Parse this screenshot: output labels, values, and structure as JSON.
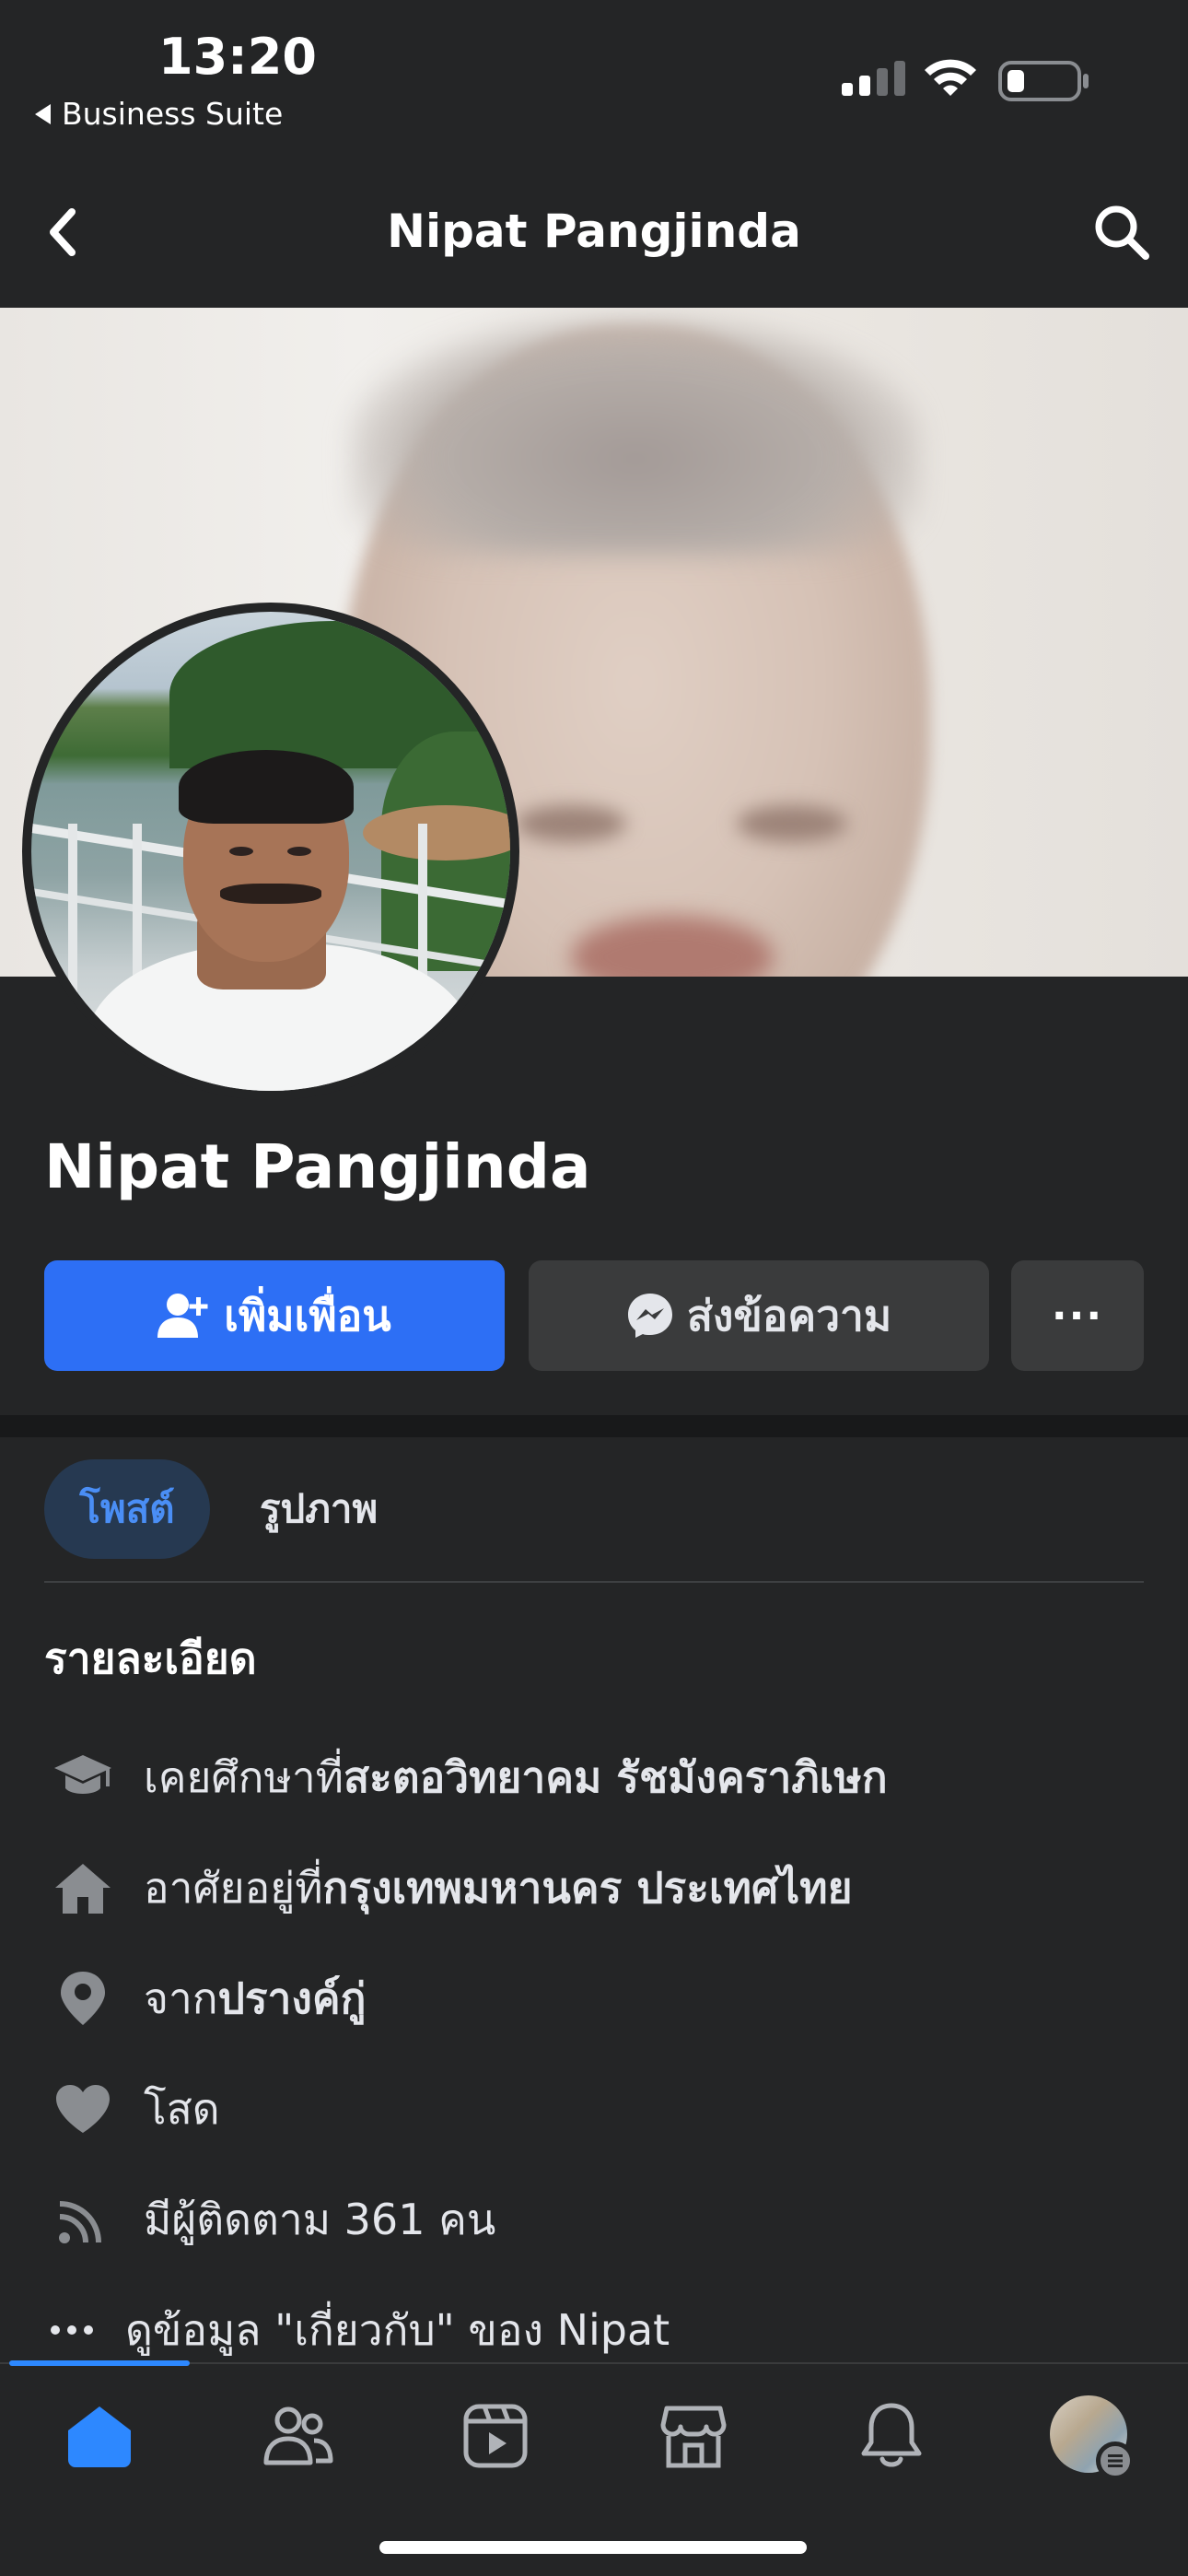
{
  "status_bar": {
    "time": "13:20",
    "back_app": "Business Suite"
  },
  "header": {
    "title": "Nipat Pangjinda"
  },
  "profile": {
    "name": "Nipat Pangjinda"
  },
  "actions": {
    "add_friend": "เพิ่มเพื่อน",
    "message": "ส่งข้อความ",
    "more": "···"
  },
  "tabs": [
    {
      "label": "โพสต์",
      "active": true
    },
    {
      "label": "รูปภาพ",
      "active": false
    }
  ],
  "details": {
    "title": "รายละเอียด",
    "items": [
      {
        "icon": "graduation-cap-icon",
        "prefix": "เคยศึกษาที่ ",
        "value": "สะตอวิทยาคม รัชมังคราภิเษก"
      },
      {
        "icon": "home-icon",
        "prefix": "อาศัยอยู่ที่ ",
        "value": "กรุงเทพมหานคร ประเทศไทย"
      },
      {
        "icon": "location-pin-icon",
        "prefix": "จาก ",
        "value": "ปรางค์กู่"
      },
      {
        "icon": "heart-icon",
        "prefix": "",
        "value": "โสด"
      },
      {
        "icon": "rss-icon",
        "prefix": "มีผู้ติดตาม 361 คน",
        "value": ""
      },
      {
        "icon": "more-dots-icon",
        "prefix": "ดูข้อมูล \"เกี่ยวกับ\" ของ Nipat",
        "value": ""
      }
    ]
  },
  "bottom_nav": [
    {
      "icon": "home-icon",
      "active": true
    },
    {
      "icon": "friends-icon",
      "active": false
    },
    {
      "icon": "video-icon",
      "active": false
    },
    {
      "icon": "marketplace-icon",
      "active": false
    },
    {
      "icon": "bell-icon",
      "active": false
    },
    {
      "icon": "profile-menu-icon",
      "active": false
    }
  ],
  "colors": {
    "background": "#242526",
    "primary": "#2d6ff5",
    "secondary_button": "#3a3b3c",
    "active_tab_bg": "#263951",
    "active_tab_text": "#4a8ef5"
  }
}
